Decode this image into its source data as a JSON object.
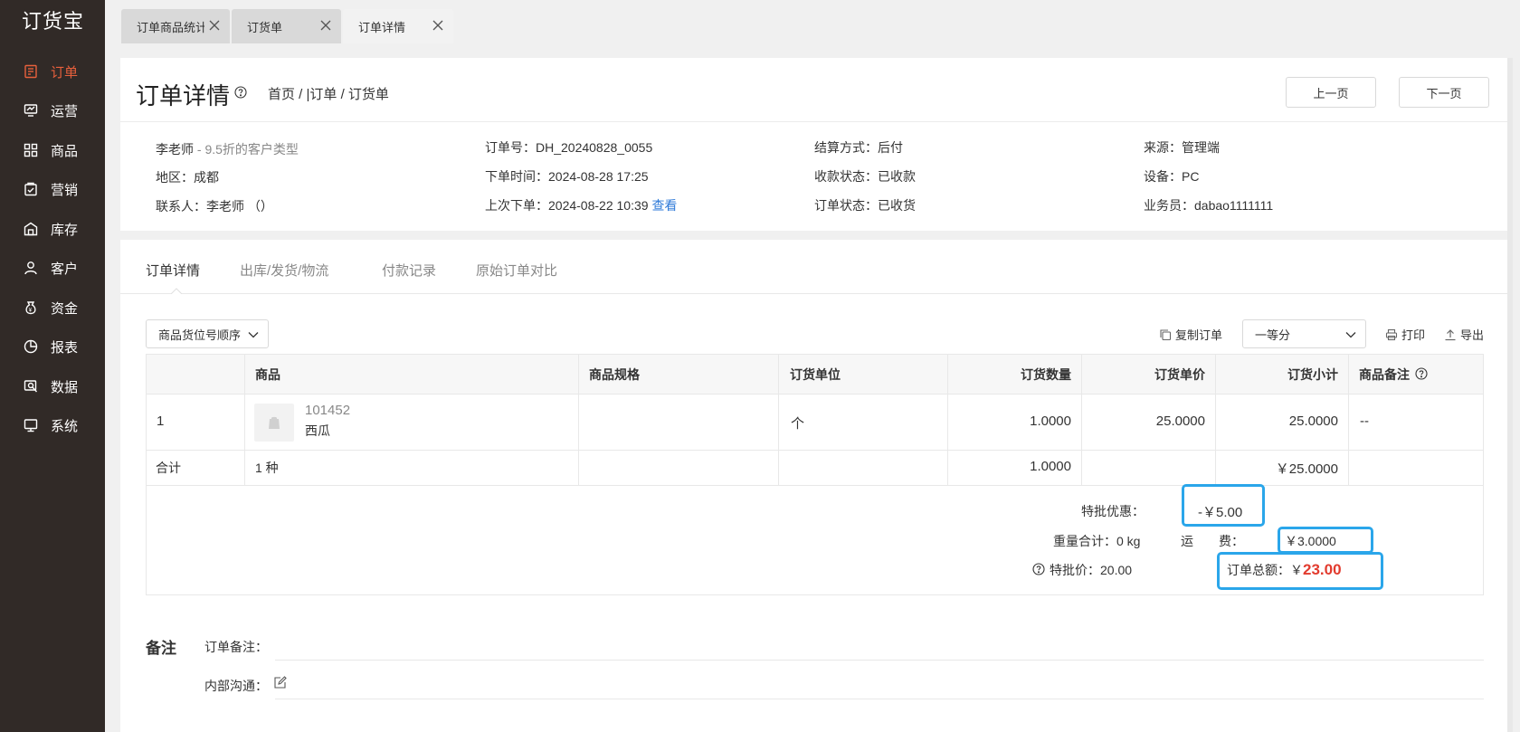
{
  "app": {
    "logo": "订货宝"
  },
  "sidebar": {
    "items": [
      {
        "label": "订单",
        "icon": "order-icon",
        "active": true
      },
      {
        "label": "运营",
        "icon": "operations-icon"
      },
      {
        "label": "商品",
        "icon": "goods-icon"
      },
      {
        "label": "营销",
        "icon": "marketing-icon"
      },
      {
        "label": "库存",
        "icon": "inventory-icon"
      },
      {
        "label": "客户",
        "icon": "customer-icon"
      },
      {
        "label": "资金",
        "icon": "funds-icon"
      },
      {
        "label": "报表",
        "icon": "report-icon"
      },
      {
        "label": "数据",
        "icon": "data-icon"
      },
      {
        "label": "系统",
        "icon": "system-icon"
      }
    ]
  },
  "tabs": [
    {
      "label": "订单商品统计"
    },
    {
      "label": "订货单"
    },
    {
      "label": "订单详情",
      "active": true
    }
  ],
  "header": {
    "title": "订单详情",
    "breadcrumb": "首页 / |订单 / 订货单",
    "prev_label": "上一页",
    "next_label": "下一页"
  },
  "info": {
    "customer_name": "李老师",
    "customer_type": " - 9.5折的客户类型",
    "region": "地区：成都",
    "contact": "联系人：李老师 （）",
    "order_no": "订单号：DH_20240828_0055",
    "order_time": "下单时间：2024-08-28 17:25",
    "last_order": "上次下单：2024-08-22 10:39",
    "view_link": "查看",
    "settlement": "结算方式：后付",
    "payment_status": "收款状态：已收款",
    "order_status": "订单状态：已收货",
    "source": "来源：管理端",
    "device": "设备：PC",
    "salesperson": "业务员：dabao1111111"
  },
  "detail_tabs": [
    "订单详情",
    "出库/发货/物流",
    "付款记录",
    "原始订单对比"
  ],
  "toolbar": {
    "sort_select": "商品货位号顺序",
    "copy_order": "复制订单",
    "grade_select": "一等分",
    "print": "打印",
    "export": "导出"
  },
  "table": {
    "headers": [
      "商品",
      "商品规格",
      "订货单位",
      "订货数量",
      "订货单价",
      "订货小计",
      "商品备注"
    ],
    "rows": [
      {
        "index": "1",
        "code": "101452",
        "name": "西瓜",
        "spec": "",
        "unit": "个",
        "qty": "1.0000",
        "price": "25.0000",
        "subtotal": "25.0000",
        "remark": "--"
      }
    ],
    "total_row": {
      "label": "合计",
      "kinds": "1 种",
      "qty": "1.0000",
      "subtotal": "￥25.0000"
    }
  },
  "summary": {
    "discount_label": "特批优惠：",
    "discount_value": "-￥5.00",
    "weight": "重量合计：0 kg",
    "freight_label": "运　　费：",
    "freight_value": "￥3.0000",
    "special_price": "特批价：20.00",
    "total_label": "订单总额：￥",
    "total_value": "23.00"
  },
  "notes": {
    "title": "备注",
    "order_note_label": "订单备注：",
    "internal_label": "内部沟通："
  },
  "colors": {
    "sidebar_bg": "#312a27",
    "accent": "#e8603c",
    "highlight_box": "#2aa6ea",
    "total_red": "#e23b2e",
    "link": "#2f7ad8"
  }
}
